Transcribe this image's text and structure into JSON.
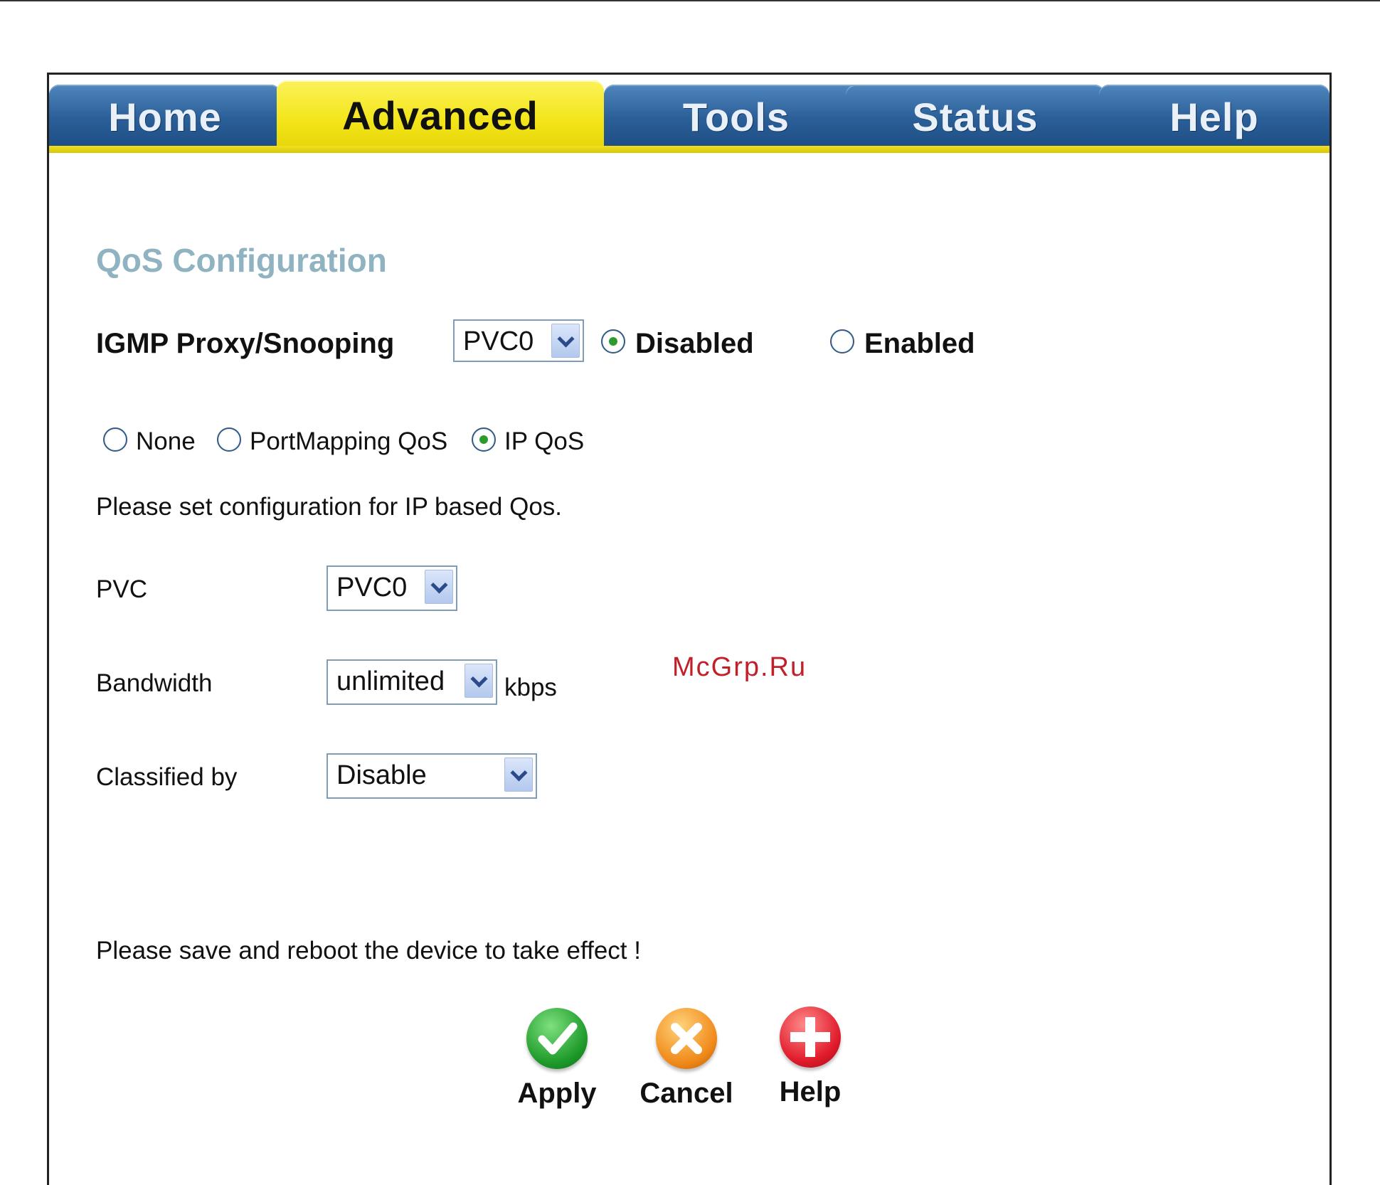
{
  "tabs": [
    {
      "label": "Home",
      "active": false
    },
    {
      "label": "Advanced",
      "active": true
    },
    {
      "label": "Tools",
      "active": false
    },
    {
      "label": "Status",
      "active": false
    },
    {
      "label": "Help",
      "active": false
    }
  ],
  "title": "QoS Configuration",
  "igmp": {
    "label": "IGMP Proxy/Snooping",
    "pvc_value": "PVC0",
    "options": [
      {
        "label": "Disabled",
        "checked": true
      },
      {
        "label": "Enabled",
        "checked": false
      }
    ]
  },
  "qos_mode": {
    "options": [
      {
        "label": "None",
        "checked": false
      },
      {
        "label": "PortMapping QoS",
        "checked": false
      },
      {
        "label": "IP QoS",
        "checked": true
      }
    ]
  },
  "instruction": "Please set configuration for IP based Qos.",
  "fields": {
    "pvc": {
      "label": "PVC",
      "value": "PVC0"
    },
    "bandwidth": {
      "label": "Bandwidth",
      "value": "unlimited",
      "unit": "kbps"
    },
    "classified_by": {
      "label": "Classified by",
      "value": "Disable"
    }
  },
  "watermark": "McGrp.Ru",
  "notice": "Please save and reboot the device to take effect !",
  "buttons": {
    "apply": {
      "label": "Apply",
      "icon": "check-icon",
      "color": "#1e9a2a"
    },
    "cancel": {
      "label": "Cancel",
      "icon": "x-icon",
      "color": "#f08a1a"
    },
    "help": {
      "label": "Help",
      "icon": "plus-icon",
      "color": "#e01a2a"
    }
  }
}
